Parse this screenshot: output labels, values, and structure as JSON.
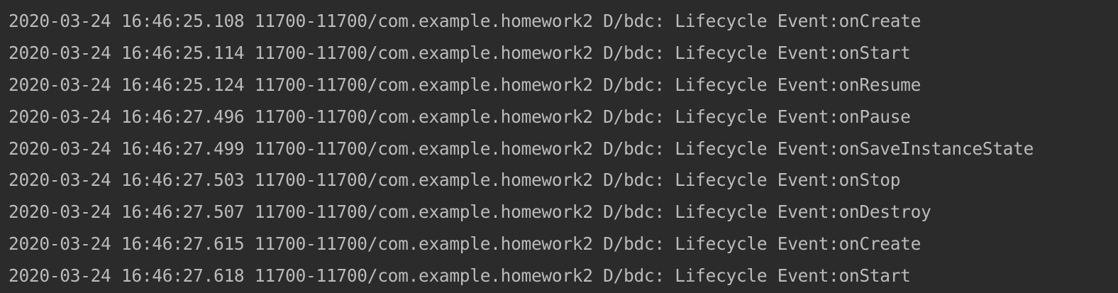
{
  "logcat": {
    "lines": [
      "2020-03-24 16:46:25.108 11700-11700/com.example.homework2 D/bdc: Lifecycle Event:onCreate",
      "2020-03-24 16:46:25.114 11700-11700/com.example.homework2 D/bdc: Lifecycle Event:onStart",
      "2020-03-24 16:46:25.124 11700-11700/com.example.homework2 D/bdc: Lifecycle Event:onResume",
      "2020-03-24 16:46:27.496 11700-11700/com.example.homework2 D/bdc: Lifecycle Event:onPause",
      "2020-03-24 16:46:27.499 11700-11700/com.example.homework2 D/bdc: Lifecycle Event:onSaveInstanceState",
      "2020-03-24 16:46:27.503 11700-11700/com.example.homework2 D/bdc: Lifecycle Event:onStop",
      "2020-03-24 16:46:27.507 11700-11700/com.example.homework2 D/bdc: Lifecycle Event:onDestroy",
      "2020-03-24 16:46:27.615 11700-11700/com.example.homework2 D/bdc: Lifecycle Event:onCreate",
      "2020-03-24 16:46:27.618 11700-11700/com.example.homework2 D/bdc: Lifecycle Event:onStart"
    ]
  },
  "colors": {
    "background": "#2b2b2b",
    "text": "#bbbbbb"
  }
}
